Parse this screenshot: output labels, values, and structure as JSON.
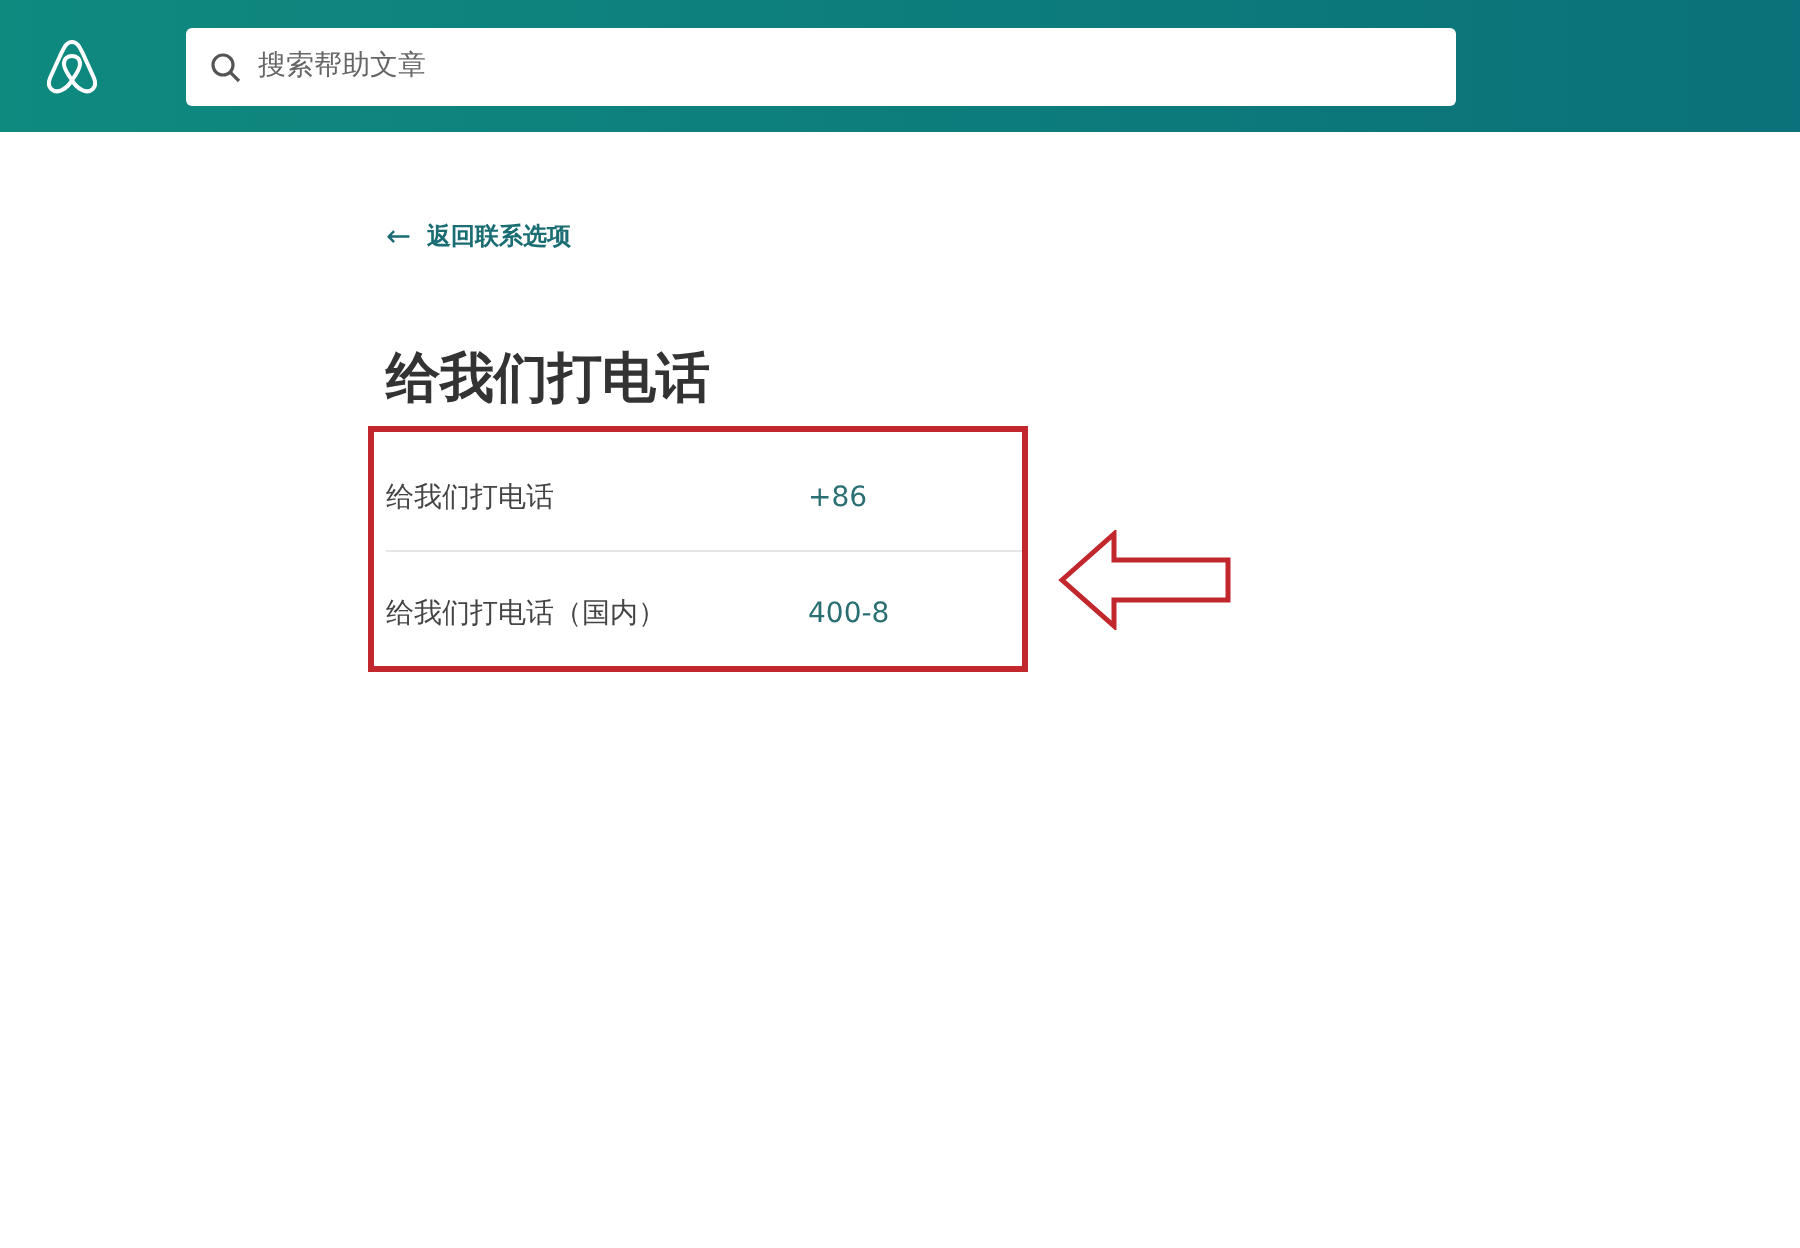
{
  "header": {
    "search": {
      "placeholder": "搜索帮助文章"
    }
  },
  "back_link": {
    "arrow": "←",
    "label": "返回联系选项"
  },
  "title": "给我们打电话",
  "phone_rows": [
    {
      "label": "给我们打电话",
      "number": "+86"
    },
    {
      "label": "给我们打电话（国内）",
      "number": "400-8"
    }
  ]
}
